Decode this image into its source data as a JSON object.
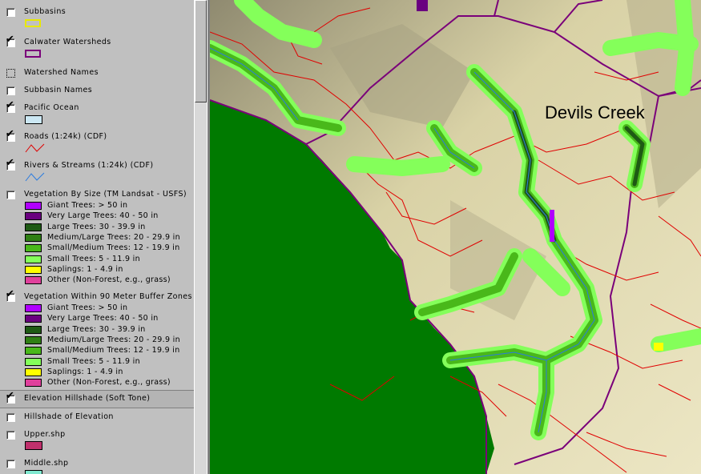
{
  "toc": {
    "layers": [
      {
        "name": "Subbasins",
        "checked": false,
        "symbol": {
          "type": "outline",
          "color": "#e8e800"
        }
      },
      {
        "name": "Calwater Watersheds",
        "checked": true,
        "symbol": {
          "type": "outline",
          "color": "#7a007a"
        }
      },
      {
        "name": "Watershed Names",
        "checked": false,
        "dotted": true
      },
      {
        "name": "Subbasin Names",
        "checked": false
      },
      {
        "name": "Pacific Ocean",
        "checked": true,
        "symbol": {
          "type": "fill",
          "color": "#cce8f4"
        }
      },
      {
        "name": "Roads (1:24k) (CDF)",
        "checked": true,
        "symbol": {
          "type": "line",
          "color": "#e00000"
        }
      },
      {
        "name": "Rivers & Streams (1:24k) (CDF)",
        "checked": true,
        "symbol": {
          "type": "line",
          "color": "#2a7be0"
        }
      },
      {
        "name": "Vegetation By Size (TM Landsat - USFS)",
        "checked": false,
        "legend": [
          {
            "label": "Giant Trees: > 50 in",
            "color": "#b000ff"
          },
          {
            "label": "Very Large Trees: 40 - 50 in",
            "color": "#6a0080"
          },
          {
            "label": "Large Trees: 30 - 39.9 in",
            "color": "#1e5a14"
          },
          {
            "label": "Medium/Large Trees: 20 - 29.9 in",
            "color": "#2f7f14"
          },
          {
            "label": "Small/Medium Trees: 12 - 19.9 in",
            "color": "#49b81a"
          },
          {
            "label": "Small Trees: 5 - 11.9 in",
            "color": "#84ff5a"
          },
          {
            "label": "Saplings: 1 - 4.9 in",
            "color": "#ffff00"
          },
          {
            "label": "Other (Non-Forest, e.g., grass)",
            "color": "#e0409c"
          }
        ]
      },
      {
        "name": "Vegetation Within 90 Meter Buffer Zones",
        "checked": true,
        "legend": [
          {
            "label": "Giant Trees: > 50 in",
            "color": "#b000ff"
          },
          {
            "label": "Very Large Trees: 40 - 50 in",
            "color": "#6a0080"
          },
          {
            "label": "Large Trees: 30 - 39.9 in",
            "color": "#1e5a14"
          },
          {
            "label": "Medium/Large Trees: 20 - 29.9 in",
            "color": "#2f7f14"
          },
          {
            "label": "Small/Medium Trees: 12 - 19.9 in",
            "color": "#49b81a"
          },
          {
            "label": "Small Trees: 5 - 11.9 in",
            "color": "#84ff5a"
          },
          {
            "label": "Saplings: 1 - 4.9 in",
            "color": "#ffff00"
          },
          {
            "label": "Other (Non-Forest, e.g., grass)",
            "color": "#e0409c"
          }
        ]
      },
      {
        "name": "Elevation Hillshade (Soft Tone)",
        "checked": true,
        "selected": true
      },
      {
        "name": "Hillshade of Elevation",
        "checked": false
      },
      {
        "name": "Upper.shp",
        "checked": false,
        "symbol": {
          "type": "fill",
          "color": "#c0306c"
        }
      },
      {
        "name": "Middle.shp",
        "checked": false,
        "symbol": {
          "type": "fill",
          "color": "#80e8d0"
        }
      }
    ]
  },
  "map": {
    "label": "Devils Creek",
    "colors": {
      "ocean": "#007a00",
      "terrain": "#d9d2a6",
      "watershed": "#7a007a",
      "roads": "#e00000",
      "streams": "#2a7be0",
      "buffer_outer": "#84ff5a",
      "buffer_mid": "#49b81a",
      "buffer_inner": "#1e5a14"
    }
  }
}
